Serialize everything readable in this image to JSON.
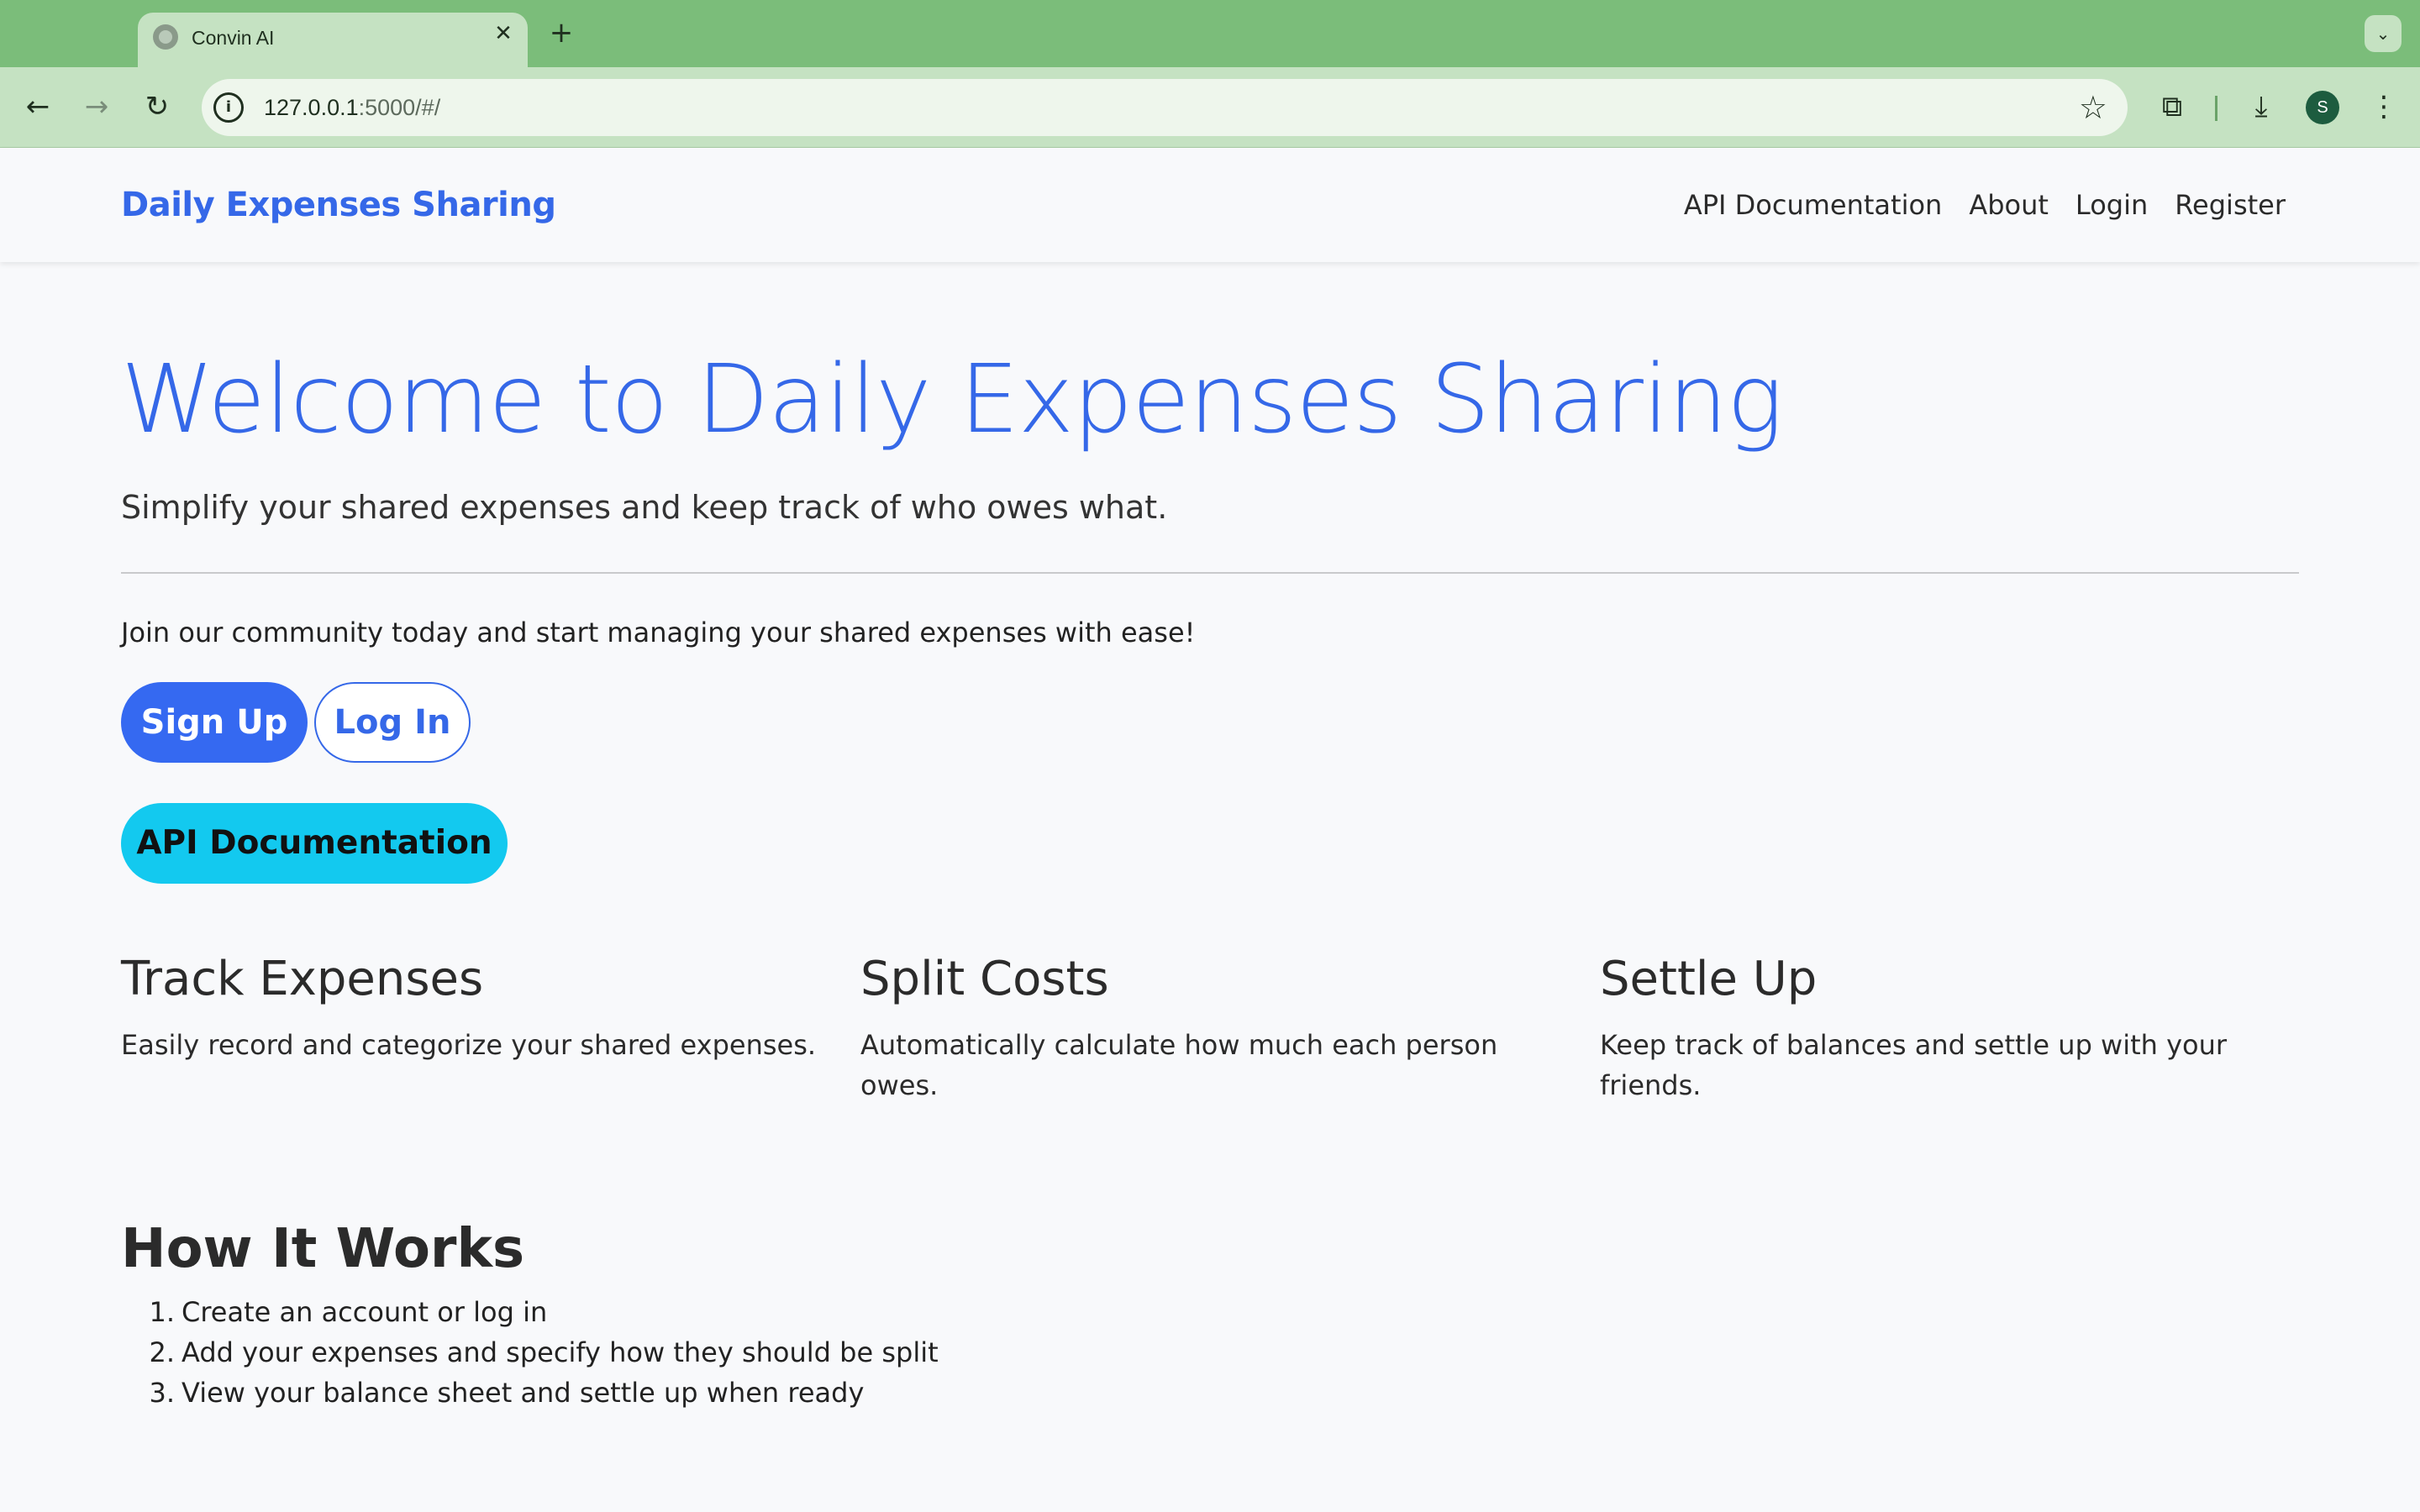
{
  "browser": {
    "tab_title": "Convin AI",
    "url_host": "127.0.0.1",
    "url_rest": ":5000/#/",
    "profile_initial": "S"
  },
  "navbar": {
    "brand": "Daily Expenses Sharing",
    "links": [
      "API Documentation",
      "About",
      "Login",
      "Register"
    ]
  },
  "hero": {
    "title": "Welcome to Daily Expenses Sharing",
    "lead": "Simplify your shared expenses and keep track of who owes what.",
    "join_text": "Join our community today and start managing your shared expenses with ease!",
    "signup_label": "Sign Up",
    "login_label": "Log In",
    "api_label": "API Documentation"
  },
  "features": [
    {
      "title": "Track Expenses",
      "text": "Easily record and categorize your shared expenses."
    },
    {
      "title": "Split Costs",
      "text": "Automatically calculate how much each person owes."
    },
    {
      "title": "Settle Up",
      "text": "Keep track of balances and settle up with your friends."
    }
  ],
  "how_it_works": {
    "title": "How It Works",
    "steps": [
      {
        "num": "1.",
        "text": "Create an account or log in"
      },
      {
        "num": "2.",
        "text": "Add your expenses and specify how they should be split"
      },
      {
        "num": "3.",
        "text": "View your balance sheet and settle up when ready"
      }
    ]
  },
  "colors": {
    "tabstrip": "#7bbd7a",
    "toolbar": "#c5e2c2",
    "brand_blue": "#3568e8",
    "primary_button": "#3569f1",
    "info_button": "#13c9ef"
  },
  "icons": {
    "back": "arrow-left",
    "forward": "arrow-right",
    "reload": "reload",
    "site_info": "info",
    "bookmark": "star",
    "extensions": "puzzle",
    "downloads": "download",
    "menu": "kebab",
    "tab_search": "chevron-down"
  }
}
